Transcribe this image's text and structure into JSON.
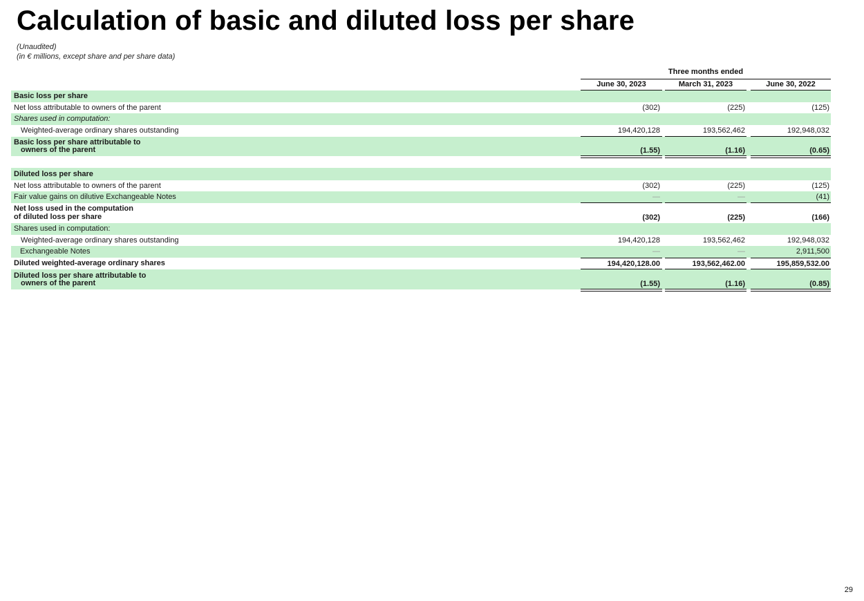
{
  "title": "Calculation of basic and diluted loss per share",
  "subtitle_1": "(Unaudited)",
  "subtitle_2": "(in € millions, except share and per share data)",
  "group_header": "Three months ended",
  "columns": [
    "June 30, 2023",
    "March 31, 2023",
    "June 30, 2022"
  ],
  "basic": {
    "header": "Basic loss per share",
    "net_loss": {
      "label": "Net loss attributable to owners of the parent",
      "values": [
        "(302)",
        "(225)",
        "(125)"
      ]
    },
    "shares_used": "Shares used in computation:",
    "weighted_avg": {
      "label": "Weighted-average ordinary shares outstanding",
      "values": [
        "194,420,128",
        "193,562,462",
        "192,948,032"
      ]
    },
    "eps": {
      "label_1": "Basic loss per share attributable to",
      "label_2": "owners of the parent",
      "values": [
        "(1.55)",
        "(1.16)",
        "(0.65)"
      ]
    }
  },
  "diluted": {
    "header": "Diluted loss per share",
    "net_loss": {
      "label": "Net loss attributable to owners of the parent",
      "values": [
        "(302)",
        "(225)",
        "(125)"
      ]
    },
    "fair_value": {
      "label": "Fair value gains on dilutive Exchangeable Notes",
      "values": [
        "—",
        "—",
        "(41)"
      ]
    },
    "net_loss_used": {
      "label_1": "Net loss used in the computation",
      "label_2": "of diluted loss per share",
      "values": [
        "(302)",
        "(225)",
        "(166)"
      ]
    },
    "shares_used": "Shares used in computation:",
    "weighted_avg": {
      "label": "Weighted-average ordinary shares outstanding",
      "values": [
        "194,420,128",
        "193,562,462",
        "192,948,032"
      ]
    },
    "exchangeable": {
      "label": "Exchangeable Notes",
      "values": [
        "—",
        "—",
        "2,911,500"
      ]
    },
    "diluted_weighted": {
      "label": "Diluted weighted-average ordinary shares",
      "values": [
        "194,420,128.00",
        "193,562,462.00",
        "195,859,532.00"
      ]
    },
    "eps": {
      "label_1": "Diluted loss per share attributable to",
      "label_2": "owners of the parent",
      "values": [
        "(1.55)",
        "(1.16)",
        "(0.85)"
      ]
    }
  },
  "page_number": "29",
  "colors": {
    "row_green": "#c6efce",
    "text": "#1a1a1a"
  }
}
